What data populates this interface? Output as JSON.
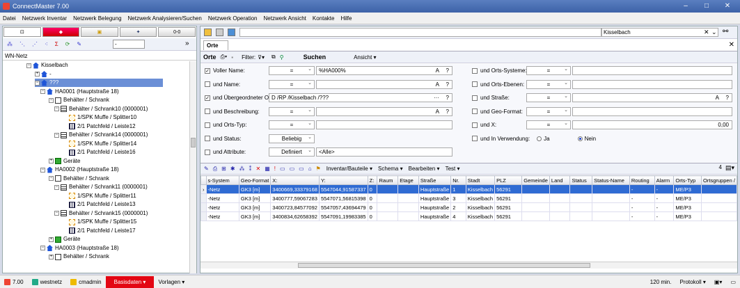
{
  "window": {
    "title": "ConnectMaster 7.00",
    "min_glyph": "–",
    "max_glyph": "□",
    "close_glyph": "✕"
  },
  "menu": [
    "Datei",
    "Netzwerk Inventar",
    "Netzwerk Belegung",
    "Netzwerk Analysieren/Suchen",
    "Netzwerk Operation",
    "Netzwerk Ansicht",
    "Kontakte",
    "Hilfe"
  ],
  "left": {
    "tabs": [
      "",
      "",
      "",
      "",
      "0-0"
    ],
    "combo_value": "-",
    "more": "»",
    "netz_label": "WN-Netz",
    "tree": [
      {
        "label": "Kisselbach",
        "icon": "home",
        "indent": 34,
        "exp": "−"
      },
      {
        "label": "-",
        "icon": "home",
        "indent": 46,
        "exp": "+"
      },
      {
        "label": "???",
        "icon": "home",
        "indent": 46,
        "exp": "−",
        "selected": true
      },
      {
        "label": "HA0001 (Hauptstraße 18)",
        "icon": "home",
        "indent": 54,
        "exp": "−"
      },
      {
        "label": "Behälter / Schrank",
        "icon": "cab",
        "indent": 66,
        "exp": "−"
      },
      {
        "label": "Behälter / Schrank10 (0000001)",
        "icon": "cab2",
        "indent": 74,
        "exp": "−"
      },
      {
        "label": "1/SPK Muffe / Splitter10",
        "icon": "spk",
        "indent": 86,
        "exp": ""
      },
      {
        "label": "2/1 Patchfeld / Leiste12",
        "icon": "patch",
        "indent": 86,
        "exp": ""
      },
      {
        "label": "Behälter / Schrank14 (0000001)",
        "icon": "cab2",
        "indent": 74,
        "exp": "−"
      },
      {
        "label": "1/SPK Muffe / Splitter14",
        "icon": "spk",
        "indent": 86,
        "exp": ""
      },
      {
        "label": "2/1 Patchfeld / Leiste16",
        "icon": "patch",
        "indent": 86,
        "exp": ""
      },
      {
        "label": "Geräte",
        "icon": "ger",
        "indent": 66,
        "exp": "+"
      },
      {
        "label": "HA0002 (Hauptstraße 18)",
        "icon": "home",
        "indent": 54,
        "exp": "−"
      },
      {
        "label": "Behälter / Schrank",
        "icon": "cab",
        "indent": 66,
        "exp": "−"
      },
      {
        "label": "Behälter / Schrank11 (0000001)",
        "icon": "cab2",
        "indent": 74,
        "exp": "−"
      },
      {
        "label": "1/SPK Muffe / Splitter11",
        "icon": "spk",
        "indent": 86,
        "exp": ""
      },
      {
        "label": "2/1 Patchfeld / Leiste13",
        "icon": "patch",
        "indent": 86,
        "exp": ""
      },
      {
        "label": "Behälter / Schrank15 (0000001)",
        "icon": "cab2",
        "indent": 74,
        "exp": "−"
      },
      {
        "label": "1/SPK Muffe / Splitter15",
        "icon": "spk",
        "indent": 86,
        "exp": ""
      },
      {
        "label": "2/1 Patchfeld / Leiste17",
        "icon": "patch",
        "indent": 86,
        "exp": ""
      },
      {
        "label": "Geräte",
        "icon": "ger",
        "indent": 66,
        "exp": "+"
      },
      {
        "label": "HA0003 (Hauptstraße 18)",
        "icon": "home",
        "indent": 54,
        "exp": "−"
      },
      {
        "label": "Behälter / Schrank",
        "icon": "cab",
        "indent": 66,
        "exp": "+"
      }
    ]
  },
  "right": {
    "search_value": "Kisselbach",
    "tab_label": "Orte",
    "filter_label": "Filter:",
    "search_button": "Suchen",
    "view_label": "Ansicht",
    "filters_left": [
      {
        "label": "Voller Name:",
        "checked": true,
        "op": "=",
        "value": "%HA000%",
        "hint": "A",
        "hint2": "?"
      },
      {
        "label": "und Name:",
        "checked": false,
        "op": "=",
        "value": "",
        "hint": "A",
        "hint2": "?"
      },
      {
        "label": "und Übergeordneter Ort:",
        "checked": true,
        "op": "",
        "value": "D /RP /Kisselbach /???",
        "hint": "···",
        "hint2": "?"
      },
      {
        "label": "und Beschreibung:",
        "checked": false,
        "op": "=",
        "value": "",
        "hint": "A",
        "hint2": "?"
      },
      {
        "label": "und Orts-Typ:",
        "checked": false,
        "op": "=",
        "value": "",
        "hint": "",
        "hint2": ""
      },
      {
        "label": "und Status:",
        "checked": false,
        "op": "Beliebig",
        "value": null,
        "hint": "",
        "hint2": ""
      },
      {
        "label": "und Attribute:",
        "checked": false,
        "op": "Definiert",
        "value": "<Alle>",
        "hint": "",
        "hint2": ""
      }
    ],
    "filters_right": [
      {
        "label": "und Orts-Systeme:",
        "op": "=",
        "value": ""
      },
      {
        "label": "und Orts-Ebenen:",
        "op": "=",
        "value": ""
      },
      {
        "label": "und Straße:",
        "op": "=",
        "value": "",
        "hint": "A",
        "hint2": "?"
      },
      {
        "label": "und Geo-Format:",
        "op": "=",
        "value": ""
      },
      {
        "label": "und X:",
        "op": "=",
        "value": "0,00"
      }
    ],
    "in_use_label": "und In Verwendung:",
    "radio_ja": "Ja",
    "radio_nein": "Nein",
    "grid_menus": [
      "Inventar/Bauteile",
      "Schema",
      "Bearbeiten",
      "Test"
    ],
    "grid_count": "4",
    "columns": [
      "s-System",
      "Geo-Format",
      "X:",
      "Y:",
      "Z:",
      "Raum",
      "Etage",
      "Straße",
      "Nr.",
      "Stadt",
      "PLZ",
      "Gemeinde",
      "Land",
      "Status",
      "Status-Name",
      "Routing",
      "Alarm",
      "Orts-Typ",
      "Ortsgruppen /"
    ],
    "rows": [
      [
        "-Netz",
        "GK3 [m]",
        "3400669,33379168",
        "5547044,91587337",
        "0",
        "",
        "",
        "Hauptstraße",
        "1",
        "Kisselbach",
        "56291",
        "",
        "",
        "",
        "",
        "-",
        "-",
        "ME/P3",
        ""
      ],
      [
        "-Netz",
        "GK3 [m]",
        "3400777,59067283",
        "5547071,56815398",
        "0",
        "",
        "",
        "Hauptstraße",
        "3",
        "Kisselbach",
        "56291",
        "",
        "",
        "",
        "",
        "-",
        "-",
        "ME/P3",
        ""
      ],
      [
        "-Netz",
        "GK3 [m]",
        "3400723,84577092",
        "5547057,43694479",
        "0",
        "",
        "",
        "Hauptstraße",
        "2",
        "Kisselbach",
        "56291",
        "",
        "",
        "",
        "",
        "-",
        "-",
        "ME/P3",
        ""
      ],
      [
        "-Netz",
        "GK3 [m]",
        "3400834,62658392",
        "5547091,19983385",
        "0",
        "",
        "",
        "Hauptstraße",
        "4",
        "Kisselbach",
        "56291",
        "",
        "",
        "",
        "",
        "-",
        "-",
        "ME/P3",
        ""
      ]
    ]
  },
  "status": {
    "version": "7.00",
    "network": "westnetz",
    "user": "cmadmin",
    "basisdaten": "Basisdaten",
    "vorlagen": "Vorlagen",
    "timeout": "120 min.",
    "protokoll": "Protokoll"
  }
}
